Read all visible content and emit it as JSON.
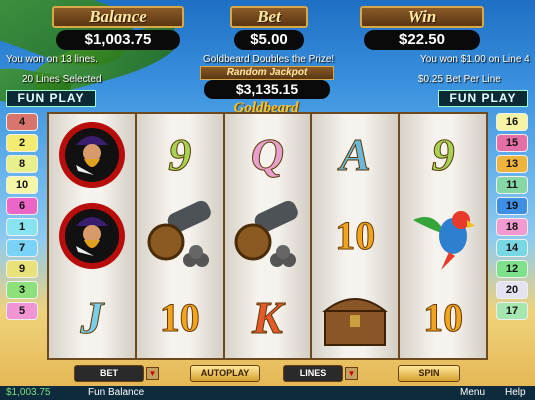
{
  "panels": {
    "balance_label": "Balance",
    "balance": "$1,003.75",
    "bet_label": "Bet",
    "bet": "$5.00",
    "win_label": "Win",
    "win": "$22.50"
  },
  "info": {
    "left1": "You won on 13 lines.",
    "center1": "Goldbeard Doubles the Prize!",
    "right1": "You won $1.00 on Line 4",
    "left2": "20 Lines Selected",
    "right2": "$0.25 Bet Per Line"
  },
  "fun_play": "FUN PLAY",
  "jackpot": {
    "label": "Random Jackpot",
    "value": "$3,135.15"
  },
  "logo": "Goldbeard",
  "left_lines": [
    "4",
    "2",
    "8",
    "10",
    "6",
    "1",
    "7",
    "9",
    "3",
    "5"
  ],
  "right_lines": [
    "16",
    "15",
    "13",
    "11",
    "19",
    "18",
    "14",
    "12",
    "20",
    "17"
  ],
  "left_colors": [
    "#d9746d",
    "#f4ec70",
    "#e7f08a",
    "#f6f7a5",
    "#ec66c8",
    "#87e4f0",
    "#7ad2f6",
    "#e9e27a",
    "#8de07a",
    "#f094d4"
  ],
  "right_colors": [
    "#f6f3a2",
    "#e36fa4",
    "#f0b43c",
    "#86d7a6",
    "#3e8fe6",
    "#f19ad0",
    "#79d7e4",
    "#7ee18b",
    "#e6e3f0",
    "#a6e7b0"
  ],
  "reels": [
    [
      {
        "type": "pirate"
      },
      {
        "type": "pirate"
      },
      {
        "type": "letter",
        "text": "J",
        "color": "#7ccde8"
      }
    ],
    [
      {
        "type": "letter",
        "text": "9",
        "color": "#a6d356"
      },
      {
        "type": "cannon"
      },
      {
        "type": "ten",
        "text": "10"
      }
    ],
    [
      {
        "type": "letter",
        "text": "Q",
        "color": "#e8a0cc"
      },
      {
        "type": "cannon"
      },
      {
        "type": "letter",
        "text": "K",
        "color": "#e65a2a"
      }
    ],
    [
      {
        "type": "letter",
        "text": "A",
        "color": "#6cb8d8"
      },
      {
        "type": "ten",
        "text": "10"
      },
      {
        "type": "chest"
      }
    ],
    [
      {
        "type": "letter",
        "text": "9",
        "color": "#a6d356"
      },
      {
        "type": "parrot"
      },
      {
        "type": "ten",
        "text": "10"
      }
    ]
  ],
  "buttons": {
    "bet": "BET",
    "autoplay": "AUTOPLAY",
    "lines": "LINES",
    "spin": "SPIN"
  },
  "status": {
    "balance": "$1,003.75",
    "label": "Fun Balance",
    "menu": "Menu",
    "help": "Help"
  }
}
